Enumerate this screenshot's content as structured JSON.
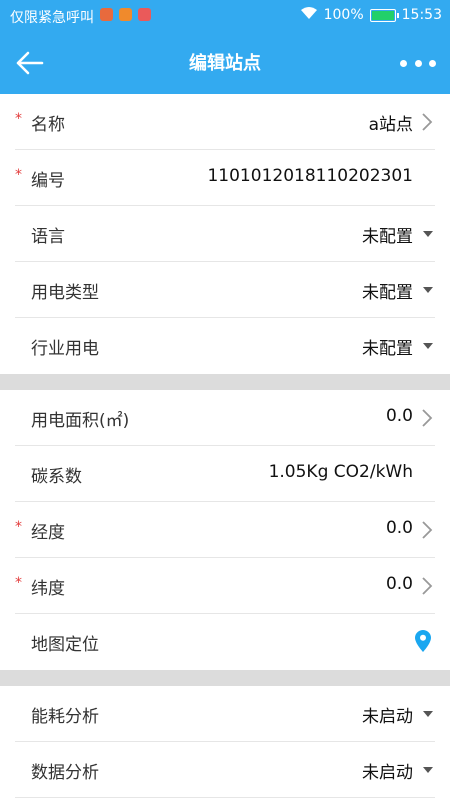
{
  "status_bar": {
    "left_text": "仅限紧急呼叫",
    "battery": "100%",
    "time": "15:53"
  },
  "app_bar": {
    "title": "编辑站点"
  },
  "section1": [
    {
      "label": "名称",
      "value": "a站点",
      "required": true,
      "control": "chevron"
    },
    {
      "label": "编号",
      "value": "110101201811020230​1",
      "required": true,
      "control": "none"
    },
    {
      "label": "语言",
      "value": "未配置",
      "required": false,
      "control": "dropdown"
    },
    {
      "label": "用电类型",
      "value": "未配置",
      "required": false,
      "control": "dropdown"
    },
    {
      "label": "行业用电",
      "value": "未配置",
      "required": false,
      "control": "dropdown"
    }
  ],
  "section2": [
    {
      "label": "用电面积(㎡)",
      "value": "0.0",
      "required": false,
      "control": "chevron"
    },
    {
      "label": "碳系数",
      "value": "1.05Kg CO2/kWh",
      "required": false,
      "control": "none"
    },
    {
      "label": "经度",
      "value": "0.0",
      "required": true,
      "control": "chevron"
    },
    {
      "label": "纬度",
      "value": "0.0",
      "required": true,
      "control": "chevron"
    },
    {
      "label": "地图定位",
      "value": "",
      "required": false,
      "control": "location-pin"
    }
  ],
  "section3": [
    {
      "label": "能耗分析",
      "value": "未启动",
      "required": false,
      "control": "dropdown"
    },
    {
      "label": "数据分析",
      "value": "未启动",
      "required": false,
      "control": "dropdown"
    }
  ],
  "colors": {
    "primary": "#33aaf0",
    "required_star": "#e23b3b",
    "pin": "#1aa7f0"
  }
}
